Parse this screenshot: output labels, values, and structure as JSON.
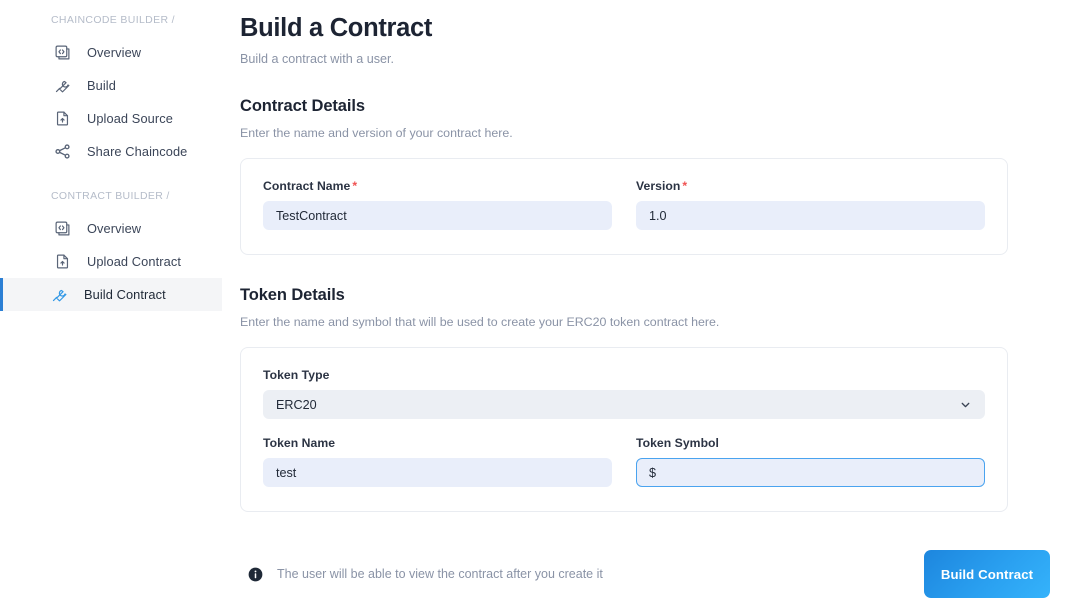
{
  "sidebar": {
    "sections": [
      {
        "title": "CHAINCODE BUILDER /",
        "items": [
          {
            "label": "Overview",
            "icon": "code-window-icon",
            "active": false
          },
          {
            "label": "Build",
            "icon": "wrench-icon",
            "active": false
          },
          {
            "label": "Upload Source",
            "icon": "document-upload-icon",
            "active": false
          },
          {
            "label": "Share Chaincode",
            "icon": "share-nodes-icon",
            "active": false
          }
        ]
      },
      {
        "title": "CONTRACT BUILDER /",
        "items": [
          {
            "label": "Overview",
            "icon": "code-window-icon",
            "active": false
          },
          {
            "label": "Upload Contract",
            "icon": "document-upload-icon",
            "active": false
          },
          {
            "label": "Build Contract",
            "icon": "wrench-icon",
            "active": true
          }
        ]
      }
    ]
  },
  "page": {
    "title": "Build a Contract",
    "subtitle": "Build a contract with a user."
  },
  "contract_details": {
    "heading": "Contract Details",
    "description": "Enter the name and version of your contract here.",
    "contract_name": {
      "label": "Contract Name",
      "required_marker": "*",
      "value": "TestContract",
      "placeholder": "Contract Name"
    },
    "version": {
      "label": "Version",
      "required_marker": "*",
      "value": "1.0",
      "placeholder": "Version"
    }
  },
  "token_details": {
    "heading": "Token Details",
    "description": "Enter the name and symbol that will be used to create your ERC20 token contract here.",
    "token_type": {
      "label": "Token Type",
      "value": "ERC20",
      "options": [
        "ERC20"
      ]
    },
    "token_name": {
      "label": "Token Name",
      "value": "test",
      "placeholder": "Token Name"
    },
    "token_symbol": {
      "label": "Token Symbol",
      "value": "$",
      "placeholder": "Token Symbol"
    }
  },
  "footer": {
    "hint_icon": "info-circle-icon",
    "hint_text": "The user will be able to view the contract after you create it",
    "submit_label": "Build Contract"
  },
  "colors": {
    "accent_blue": "#2b7fd4",
    "button_gradient_start": "#1d86de",
    "button_gradient_end": "#35b3fb",
    "required_red": "#f05252",
    "input_fill": "#e9eefa",
    "select_fill": "#eceff4",
    "muted_text": "#8a93a6"
  }
}
